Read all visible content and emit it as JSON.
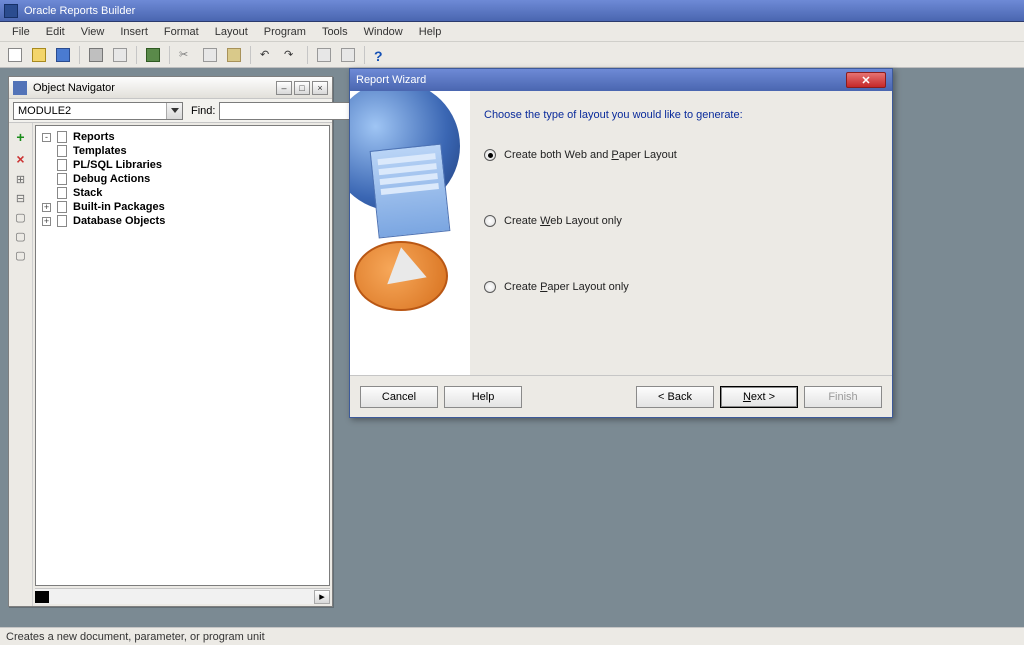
{
  "app": {
    "title": "Oracle Reports Builder"
  },
  "menu": [
    "File",
    "Edit",
    "View",
    "Insert",
    "Format",
    "Layout",
    "Program",
    "Tools",
    "Window",
    "Help"
  ],
  "navigator": {
    "title": "Object Navigator",
    "module": "MODULE2",
    "find_label": "Find:",
    "find_value": "",
    "items": [
      {
        "label": "Reports",
        "expander": "-"
      },
      {
        "label": "Templates",
        "expander": ""
      },
      {
        "label": "PL/SQL Libraries",
        "expander": ""
      },
      {
        "label": "Debug Actions",
        "expander": ""
      },
      {
        "label": "Stack",
        "expander": ""
      },
      {
        "label": "Built-in Packages",
        "expander": "+"
      },
      {
        "label": "Database Objects",
        "expander": "+"
      }
    ]
  },
  "wizard": {
    "title": "Report Wizard",
    "prompt": "Choose the type of layout you would like to generate:",
    "options": [
      {
        "label_pre": "Create both Web and ",
        "u": "P",
        "label_post": "aper Layout",
        "selected": true
      },
      {
        "label_pre": "Create ",
        "u": "W",
        "label_post": "eb Layout only",
        "selected": false
      },
      {
        "label_pre": "Create ",
        "u": "P",
        "label_post": "aper Layout only",
        "selected": false
      }
    ],
    "buttons": {
      "cancel": "Cancel",
      "help": "Help",
      "back": "< Back",
      "next": "Next >",
      "finish": "Finish"
    }
  },
  "status": "Creates a new document, parameter, or program unit"
}
